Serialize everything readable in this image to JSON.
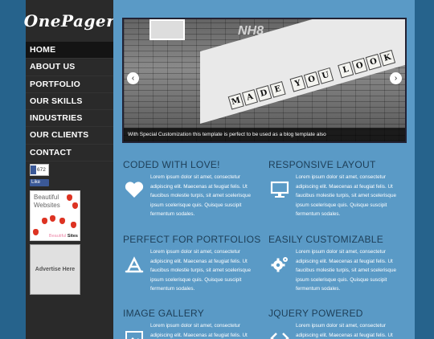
{
  "site": {
    "logo": "OnePager"
  },
  "nav": {
    "items": [
      "Home",
      "About Us",
      "Portfolio",
      "Our Skills",
      "Industries",
      "Our Clients",
      "Contact"
    ]
  },
  "facebook": {
    "count": "672",
    "like_label": "Like"
  },
  "ads": {
    "ad1": {
      "title": "Beautiful Websites",
      "brand_prefix": "Beautiful",
      "brand_suffix": "Sites"
    },
    "ad2": {
      "label": "Advertise Here"
    }
  },
  "slider": {
    "caption": "With Special Customization this template is perfect to be used as a blog template also",
    "prev_label": "‹",
    "next_label": "›",
    "graffiti": "NH8",
    "tiles": [
      "M",
      "A",
      "D",
      "E",
      "",
      "Y",
      "O",
      "U",
      "",
      "L",
      "O",
      "O",
      "K"
    ]
  },
  "features": [
    {
      "title": "Coded with love!",
      "icon": "heart-icon",
      "text": "Lorem ipsum dolor sit amet, consectetur adipiscing elit. Maecenas at feugiat felis. Ut faucibus molestie turpis, sit amet scelerisque ipsum scelerisque quis. Quisque suscipit fermentum sodales."
    },
    {
      "title": "Responsive Layout",
      "icon": "monitor-icon",
      "text": "Lorem ipsum dolor sit amet, consectetur adipiscing elit. Maecenas at feugiat felis. Ut faucibus molestie turpis, sit amet scelerisque ipsum scelerisque quis. Quisque suscipit fermentum sodales."
    },
    {
      "title": "Perfect for portfolios",
      "icon": "app-store-icon",
      "text": "Lorem ipsum dolor sit amet, consectetur adipiscing elit. Maecenas at feugiat felis. Ut faucibus molestie turpis, sit amet scelerisque ipsum scelerisque quis. Quisque suscipit fermentum sodales."
    },
    {
      "title": "Easily Customizable",
      "icon": "gears-icon",
      "text": "Lorem ipsum dolor sit amet, consectetur adipiscing elit. Maecenas at feugiat felis. Ut faucibus molestie turpis, sit amet scelerisque ipsum scelerisque quis. Quisque suscipit fermentum sodales."
    },
    {
      "title": "Image Gallery",
      "icon": "image-icon",
      "text": "Lorem ipsum dolor sit amet, consectetur adipiscing elit. Maecenas at feugiat felis. Ut"
    },
    {
      "title": "jQuery Powered",
      "icon": "code-icon",
      "text": "Lorem ipsum dolor sit amet, consectetur adipiscing elit. Maecenas at feugiat felis. Ut"
    }
  ],
  "colors": {
    "background": "#26638c",
    "sidebar": "#2a2a2a",
    "content": "#5a9ac6",
    "heading": "#1d3e57"
  }
}
